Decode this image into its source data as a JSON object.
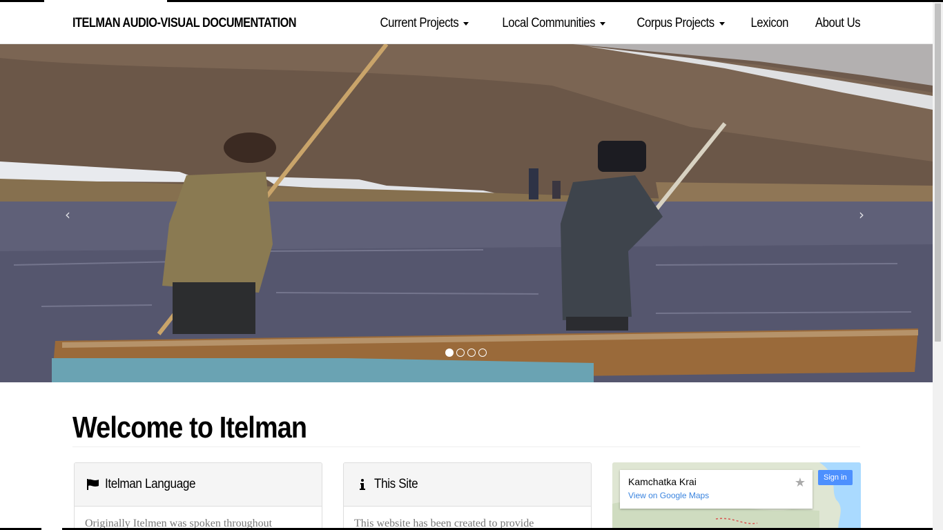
{
  "navbar": {
    "brand": "ITELMAN AUDIO-VISUAL DOCUMENTATION",
    "items": [
      {
        "label": "Current Projects",
        "dropdown": true
      },
      {
        "label": "Local Communities",
        "dropdown": true
      },
      {
        "label": "Corpus Projects",
        "dropdown": true
      },
      {
        "label": "Lexicon",
        "dropdown": false
      },
      {
        "label": "About Us",
        "dropdown": false
      }
    ]
  },
  "carousel": {
    "image": "two-men-poling-a-boat-on-a-river",
    "prev_icon": "chevron-left-icon",
    "prev_glyph": "‹",
    "next_icon": "chevron-right-icon",
    "next_glyph": "›",
    "slide_count": 4,
    "active_slide": 1
  },
  "main": {
    "heading": "Welcome to Itelman",
    "panels": [
      {
        "icon": "flag-icon",
        "title": "Itelman Language",
        "body": "Originally Itelmen was spoken throughout"
      },
      {
        "icon": "info-icon",
        "title": "This Site",
        "body": "This website has been created to provide"
      }
    ]
  },
  "map": {
    "title": "Kamchatka Krai",
    "link": "View on Google Maps",
    "star_glyph": "★",
    "signin": "Sign in"
  },
  "colors": {
    "link_blue": "#3a84df",
    "signin_blue": "#4d90fe",
    "panel_heading_bg": "#f5f5f5"
  }
}
